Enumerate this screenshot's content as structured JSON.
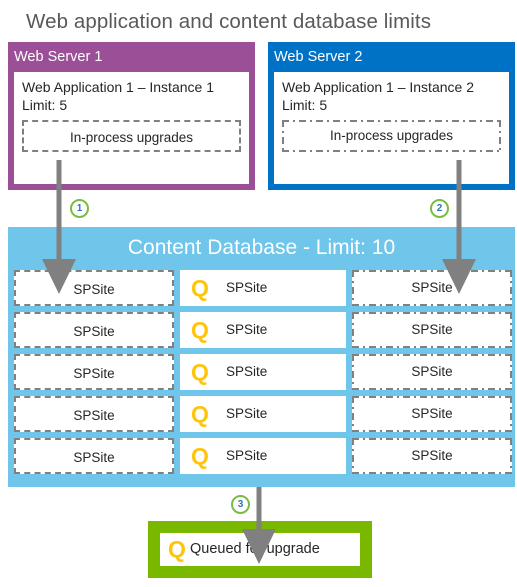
{
  "title": "Web application and content database limits",
  "colors": {
    "web_server_1": "#9b4f96",
    "web_server_2": "#0072c6",
    "content_database": "#6fc5ea",
    "queued_box": "#7ab800",
    "queue_glyph": "#ffc50d",
    "badge_ring": "#79bc43",
    "badge_number": "#2e75b6",
    "arrow": "#808080",
    "title_text": "#595959"
  },
  "servers": [
    {
      "title": "Web Server 1",
      "app_line_1": "Web Application 1 – Instance 1",
      "app_line_2": "Limit: 5",
      "inprocess_label": "In-process upgrades",
      "border_style": "dashed"
    },
    {
      "title": "Web Server 2",
      "app_line_1": "Web Application 1 – Instance 2",
      "app_line_2": "Limit: 5",
      "inprocess_label": "In-process upgrades",
      "border_style": "dash-dot"
    }
  ],
  "database": {
    "title": "Content Database - Limit: 10",
    "columns": [
      {
        "style": "dashed",
        "queue_glyph": "",
        "cells": [
          "SPSite",
          "SPSite",
          "SPSite",
          "SPSite",
          "SPSite"
        ]
      },
      {
        "style": "solid",
        "queue_glyph": "Q",
        "cells": [
          "SPSite",
          "SPSite",
          "SPSite",
          "SPSite",
          "SPSite"
        ]
      },
      {
        "style": "dash-dot",
        "queue_glyph": "",
        "cells": [
          "SPSite",
          "SPSite",
          "SPSite",
          "SPSite",
          "SPSite"
        ]
      }
    ]
  },
  "queued": {
    "glyph": "Q",
    "label": "Queued for upgrade"
  },
  "badges": [
    {
      "number": "1"
    },
    {
      "number": "2"
    },
    {
      "number": "3"
    }
  ]
}
